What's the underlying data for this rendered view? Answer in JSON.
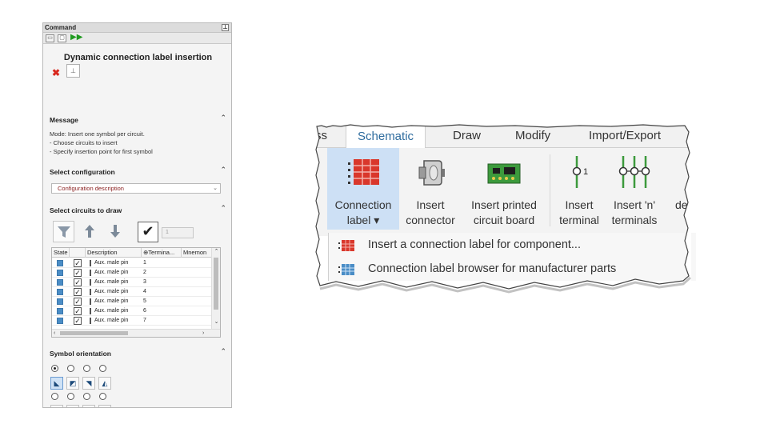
{
  "panel": {
    "title": "Command",
    "pin_glyph": "⊥",
    "heading": "Dynamic connection label insertion",
    "cancel_glyph": "✖",
    "pin_small_glyph": "📌",
    "message_title": "Message",
    "message_lines": [
      "Mode: Insert one symbol per circuit.",
      "- Choose circuits to insert",
      "- Specify insertion point for first symbol"
    ],
    "config_title": "Select configuration",
    "config_value": "Configuration description",
    "circuits_title": "Select circuits to draw",
    "count_placeholder": "1",
    "grid_headers": [
      "State",
      "",
      "Description",
      "⊕Termina...",
      "Mnemon"
    ],
    "rows": [
      {
        "description": "Aux. male pin",
        "terminal": "1"
      },
      {
        "description": "Aux. male pin",
        "terminal": "2"
      },
      {
        "description": "Aux. male pin",
        "terminal": "3"
      },
      {
        "description": "Aux. male pin",
        "terminal": "4"
      },
      {
        "description": "Aux. male pin",
        "terminal": "5"
      },
      {
        "description": "Aux. male pin",
        "terminal": "6"
      },
      {
        "description": "Aux. male pin",
        "terminal": "7"
      }
    ],
    "orientation_title": "Symbol orientation",
    "collapse_glyph": "⌃"
  },
  "ribbon": {
    "tabs": [
      "ss",
      "Schematic",
      "Draw",
      "Modify",
      "Import/Export"
    ],
    "active_tab": "Schematic",
    "buttons": [
      {
        "line1": "Connection",
        "line2": "label ▾",
        "icon": "connection-label-icon"
      },
      {
        "line1": "Insert",
        "line2": "connector",
        "icon": "connector-icon"
      },
      {
        "line1": "Insert printed",
        "line2": "circuit board",
        "icon": "pcb-icon"
      },
      {
        "line1": "Insert",
        "line2": "terminal",
        "icon": "terminal-icon"
      },
      {
        "line1": "Insert 'n'",
        "line2": "terminals",
        "icon": "terminals-icon"
      },
      {
        "line1": "",
        "line2": "de",
        "icon": ""
      }
    ],
    "terminal_number": "1",
    "menu_items": [
      "Insert a connection label for component...",
      "Connection label browser for manufacturer parts"
    ]
  },
  "colors": {
    "accent_blue": "#2e6c9e",
    "highlight": "#cde0f5",
    "label_red": "#d9372b",
    "pcb_green": "#3c9a3c"
  }
}
